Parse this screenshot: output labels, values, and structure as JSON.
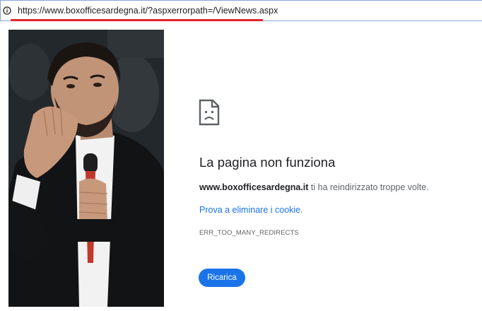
{
  "address_bar": {
    "url": "https://www.boxofficesardegna.it/?aspxerrorpath=/ViewNews.aspx",
    "icon": "info-icon",
    "underline_color": "#e0242a"
  },
  "photo": {
    "description_icon": "photo-image"
  },
  "error": {
    "icon": "sad-document-icon",
    "title": "La pagina non funziona",
    "domain": "www.boxofficesardegna.it",
    "message": " ti ha reindirizzato troppe volte.",
    "suggestion": "Prova a eliminare i cookie",
    "suggestion_suffix": ".",
    "code": "ERR_TOO_MANY_REDIRECTS",
    "reload_label": "Ricarica"
  },
  "colors": {
    "accent": "#1a73e8",
    "text": "#202124",
    "secondary_text": "#5f6368"
  }
}
